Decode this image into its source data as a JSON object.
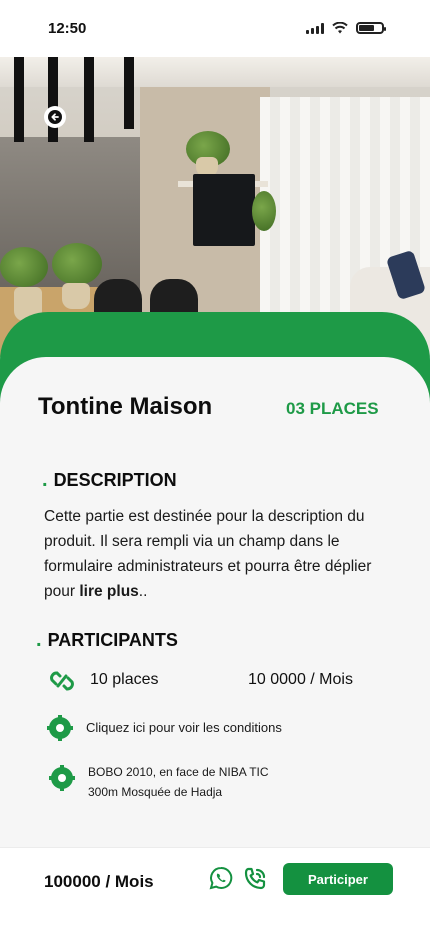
{
  "status_bar": {
    "time": "12:50"
  },
  "product": {
    "title": "Tontine Maison",
    "places_badge": "03 PLACES"
  },
  "description": {
    "heading": "DESCRIPTION",
    "text": "Cette partie est destinée pour la description du produit. Il sera rempli via un champ dans le formulaire administrateurs et pourra être déplier pour ",
    "read_more": "lire plus",
    "ellipsis": ".."
  },
  "participants": {
    "heading": "PARTICIPANTS",
    "places": "10 places",
    "price": "10 0000 / Mois",
    "conditions_link": "Cliquez ici pour voir les conditions",
    "address_line1": "BOBO 2010, en face de NIBA TIC",
    "address_line2": "300m Mosquée de Hadja"
  },
  "footer": {
    "total": "100000 / Mois",
    "cta_label": "Participer"
  },
  "colors": {
    "accent": "#1e9a47",
    "cta": "#149140",
    "sheet": "#f6f6f6"
  }
}
